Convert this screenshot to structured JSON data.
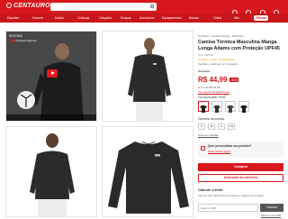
{
  "header": {
    "logo": "CENTAURO",
    "search_placeholder": "O que você procura?"
  },
  "nav": {
    "items": [
      "Esportes",
      "Homem",
      "Mulher",
      "Crianças",
      "Calçados",
      "Roupas",
      "Acessórios",
      "Equipamentos",
      "Marcas",
      "Outlet",
      "Hits",
      "Ofertas"
    ]
  },
  "gallery": {
    "video_title": "SECOND",
    "video_channel": "Centauro Esporte"
  },
  "product": {
    "breadcrumb": [
      "Centauro",
      "Camisa Manga",
      "Masculino"
    ],
    "title_line1": "Camisa Térmica Masculina Manga",
    "title_line2": "Longa Adams com Proteção UPF45",
    "sku": "Cód: 958712",
    "rating_text": "★★★★☆ (4,3) · 12 avaliações",
    "seller": "Vendido e entregue por Centauro",
    "old_price": "R$ 89,99",
    "price": "R$ 44,99",
    "discount": "-50%",
    "installments": "ou 1x de R$ 44,99",
    "see_more": "Ver opções de pagamento",
    "color_label": "Cor do produto: Preto",
    "size_label": "Tamanho do produto",
    "sizes": [
      "P",
      "M",
      "G",
      "GG"
    ],
    "size_guide": "Guia de medidas",
    "personalize_title": "Quer personalizar seu produto?",
    "personalize_link": "Personalizar agora",
    "buy_label": "Comprar",
    "cart_label": "Adicionar ao carrinho",
    "shipping_title": "Calcule o frete",
    "shipping_text": "Informe seu CEP para ver prazos e valores de entrega",
    "cep_placeholder": "Digite o CEP",
    "cep_button": "Calcular",
    "cep_help": "Não sei meu CEP"
  }
}
